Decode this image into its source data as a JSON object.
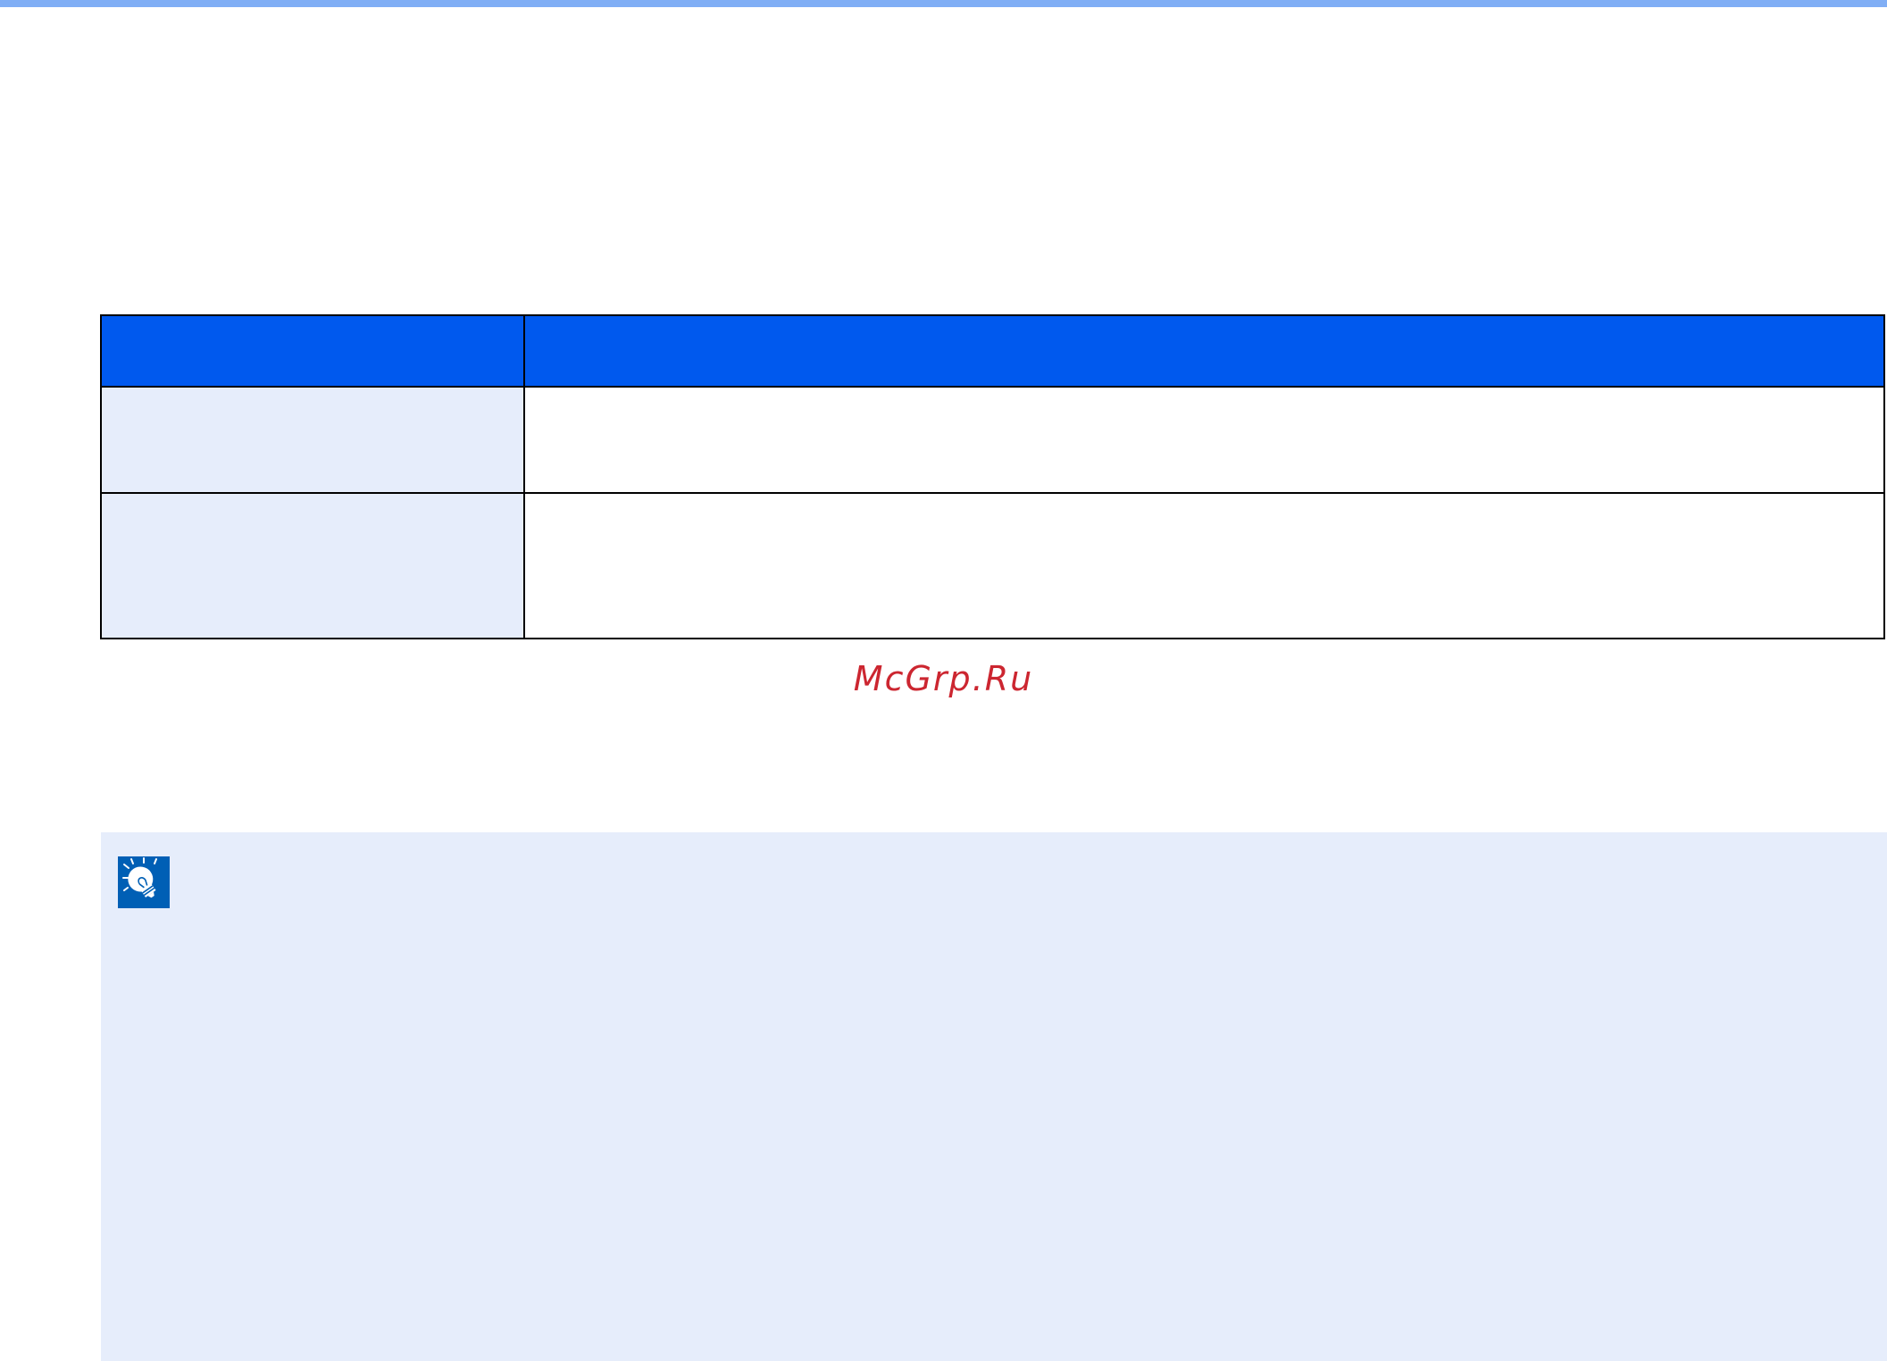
{
  "table": {
    "header": [
      "",
      ""
    ],
    "rows": [
      [
        "",
        ""
      ],
      [
        "",
        ""
      ]
    ]
  },
  "watermark": "McGrp.Ru",
  "note": {
    "icon": "lightbulb-icon",
    "text": ""
  },
  "colors": {
    "top_rule": "#80aef5",
    "table_header": "#0059ee",
    "label_cell": "#e6edfb",
    "note_background": "#e6edfb",
    "watermark": "#cc2630",
    "icon_background": "#005fb5"
  }
}
